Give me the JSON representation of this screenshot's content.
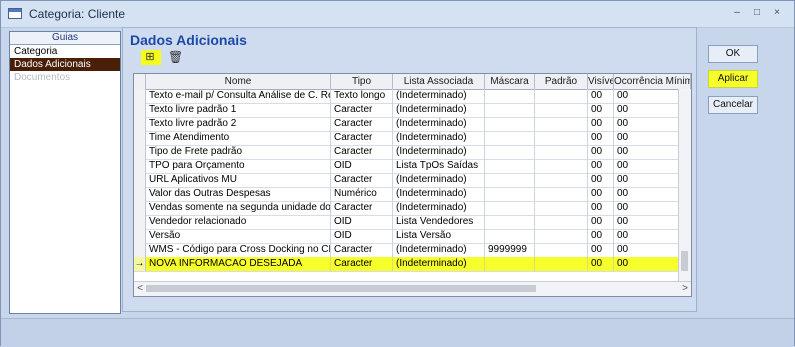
{
  "window": {
    "title": "Categoria: Cliente",
    "controls": [
      "–",
      "□",
      "×"
    ]
  },
  "nav": {
    "header": "Guias",
    "items": [
      {
        "label": "Categoria",
        "state": "normal"
      },
      {
        "label": "Dados Adicionais",
        "state": "selected"
      },
      {
        "label": "Documentos",
        "state": "disabled"
      }
    ]
  },
  "main": {
    "title": "Dados Adicionais",
    "toolbar": {
      "add_icon": "add-field-icon",
      "delete_icon": "trash-icon"
    },
    "table": {
      "columns": [
        "Nome",
        "Tipo",
        "Lista Associada",
        "Máscara",
        "Padrão",
        "Visível",
        "Ocorrência Mínim"
      ],
      "rows": [
        {
          "indicator": "",
          "nome": "Texto e-mail p/ Consulta Análise de C. Receber",
          "tipo": "Texto longo",
          "lista": "(Indeterminado)",
          "mascara": "",
          "padrao": "",
          "visivel": "00",
          "ocorrencia": "00"
        },
        {
          "indicator": "",
          "nome": "Texto livre padrão 1",
          "tipo": "Caracter",
          "lista": "(Indeterminado)",
          "mascara": "",
          "padrao": "",
          "visivel": "00",
          "ocorrencia": "00"
        },
        {
          "indicator": "",
          "nome": "Texto livre padrão 2",
          "tipo": "Caracter",
          "lista": "(Indeterminado)",
          "mascara": "",
          "padrao": "",
          "visivel": "00",
          "ocorrencia": "00"
        },
        {
          "indicator": "",
          "nome": "Time Atendimento",
          "tipo": "Caracter",
          "lista": "(Indeterminado)",
          "mascara": "",
          "padrao": "",
          "visivel": "00",
          "ocorrencia": "00"
        },
        {
          "indicator": "",
          "nome": "Tipo de Frete padrão",
          "tipo": "Caracter",
          "lista": "(Indeterminado)",
          "mascara": "",
          "padrao": "",
          "visivel": "00",
          "ocorrencia": "00"
        },
        {
          "indicator": "",
          "nome": "TPO para Orçamento",
          "tipo": "OID",
          "lista": "Lista TpOs Saídas",
          "mascara": "",
          "padrao": "",
          "visivel": "00",
          "ocorrencia": "00"
        },
        {
          "indicator": "",
          "nome": "URL Aplicativos MU",
          "tipo": "Caracter",
          "lista": "(Indeterminado)",
          "mascara": "",
          "padrao": "",
          "visivel": "00",
          "ocorrencia": "00"
        },
        {
          "indicator": "",
          "nome": "Valor das Outras Despesas",
          "tipo": "Numérico",
          "lista": "(Indeterminado)",
          "mascara": "",
          "padrao": "",
          "visivel": "00",
          "ocorrencia": "00"
        },
        {
          "indicator": "",
          "nome": "Vendas somente na segunda unidade do produto",
          "tipo": "Caracter",
          "lista": "(Indeterminado)",
          "mascara": "",
          "padrao": "",
          "visivel": "00",
          "ocorrencia": "00"
        },
        {
          "indicator": "",
          "nome": "Vendedor relacionado",
          "tipo": "OID",
          "lista": "Lista Vendedores",
          "mascara": "",
          "padrao": "",
          "visivel": "00",
          "ocorrencia": "00"
        },
        {
          "indicator": "",
          "nome": "Versão",
          "tipo": "OID",
          "lista": "Lista Versão",
          "mascara": "",
          "padrao": "",
          "visivel": "00",
          "ocorrencia": "00"
        },
        {
          "indicator": "",
          "nome": "WMS - Código para Cross Docking no CD",
          "tipo": "Caracter",
          "lista": "(Indeterminado)",
          "mascara": "9999999",
          "padrao": "",
          "visivel": "00",
          "ocorrencia": "00"
        },
        {
          "indicator": "→",
          "nome": "NOVA INFORMACAO DESEJADA",
          "tipo": "Caracter",
          "lista": "(Indeterminado)",
          "mascara": "",
          "padrao": "",
          "visivel": "00",
          "ocorrencia": "00",
          "highlight": true
        }
      ]
    }
  },
  "buttons": {
    "ok": "OK",
    "apply": "Aplicar",
    "cancel": "Cancelar"
  },
  "colors": {
    "highlight": "#f6ff2b",
    "nav_selected": "#4a1f07",
    "title_blue": "#1d49a6"
  }
}
